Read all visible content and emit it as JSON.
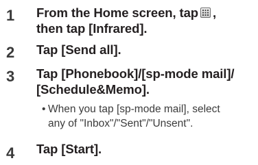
{
  "steps": [
    {
      "number": "1",
      "line1_before_icon": "From the Home screen, tap",
      "line1_after_icon": ",",
      "line2": "then tap [Infrared]."
    },
    {
      "number": "2",
      "line1": "Tap [Send all]."
    },
    {
      "number": "3",
      "line1": "Tap [Phonebook]/[sp-mode mail]/",
      "line2": "[Schedule&Memo].",
      "note_bullet": "•",
      "note_line1": "When you tap [sp-mode mail], select",
      "note_line2": "any of \"Inbox\"/\"Sent\"/\"Unsent\"."
    },
    {
      "number": "4",
      "line1": "Tap [Start]."
    }
  ],
  "icons": {
    "apps_icon": "apps-grid-icon"
  }
}
